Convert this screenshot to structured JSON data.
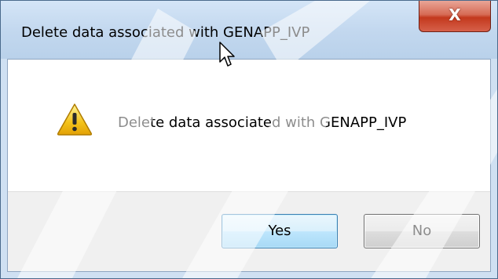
{
  "dialog": {
    "title": "Delete data associated with GENAPP_IVP",
    "message": "Delete data associated with GENAPP_IVP",
    "close_label": "X",
    "buttons": {
      "yes_label": "Yes",
      "no_label": "No"
    },
    "icon": "warning-icon"
  },
  "colors": {
    "titlebar": "#c3d8ef",
    "close_button": "#c3391d",
    "button_bar": "#f0f0f0",
    "default_button_border": "#3c7fb1"
  }
}
